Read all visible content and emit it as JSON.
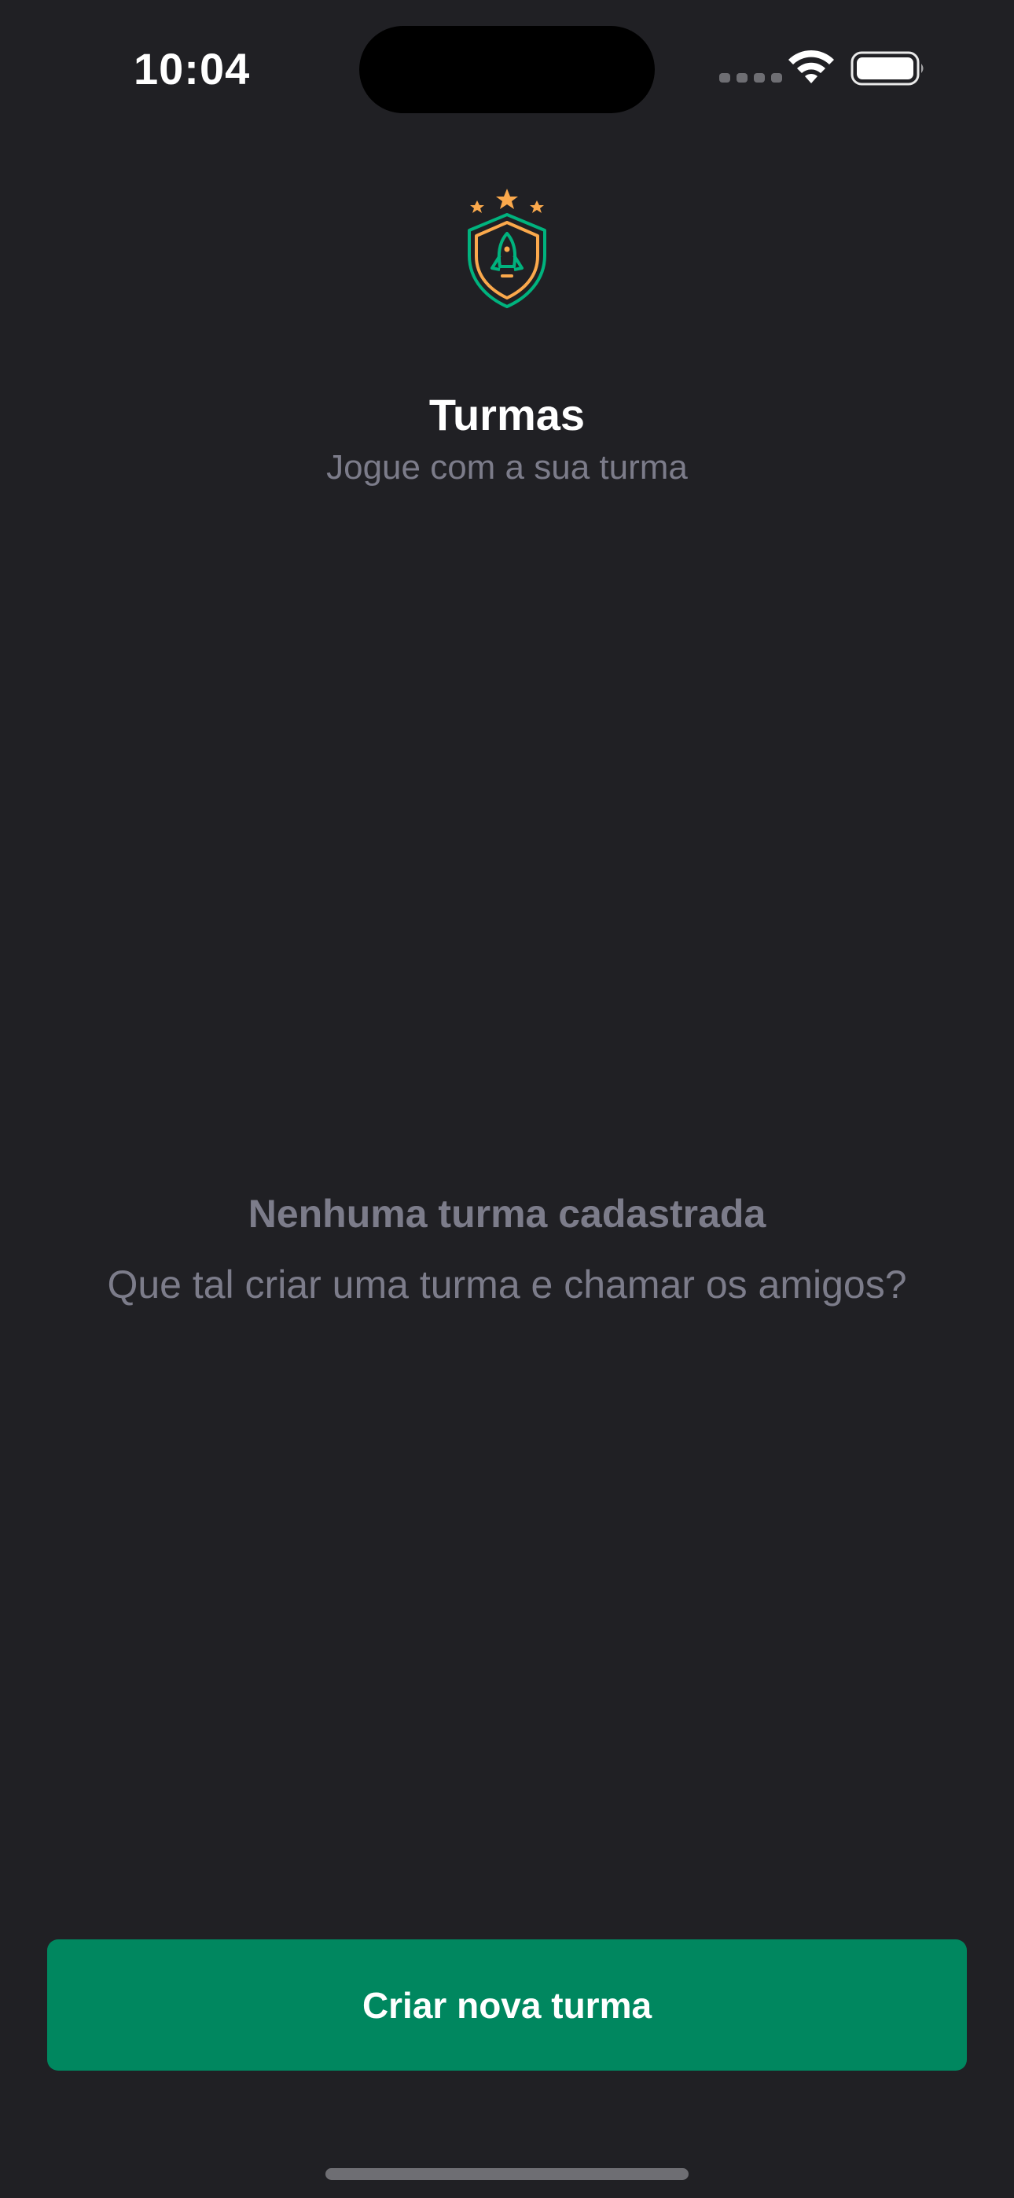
{
  "status_bar": {
    "time": "10:04"
  },
  "header": {
    "logo_icon": "shield-rocket-icon",
    "title": "Turmas",
    "subtitle": "Jogue com a sua turma"
  },
  "empty_state": {
    "title": "Nenhuma turma cadastrada",
    "message": "Que tal criar uma turma e chamar os amigos?"
  },
  "actions": {
    "create_label": "Criar nova turma"
  },
  "colors": {
    "background": "#202024",
    "primary": "#00875f",
    "accent_orange": "#fba94c",
    "text_muted": "#7c7c8a",
    "text_white": "#ffffff"
  }
}
